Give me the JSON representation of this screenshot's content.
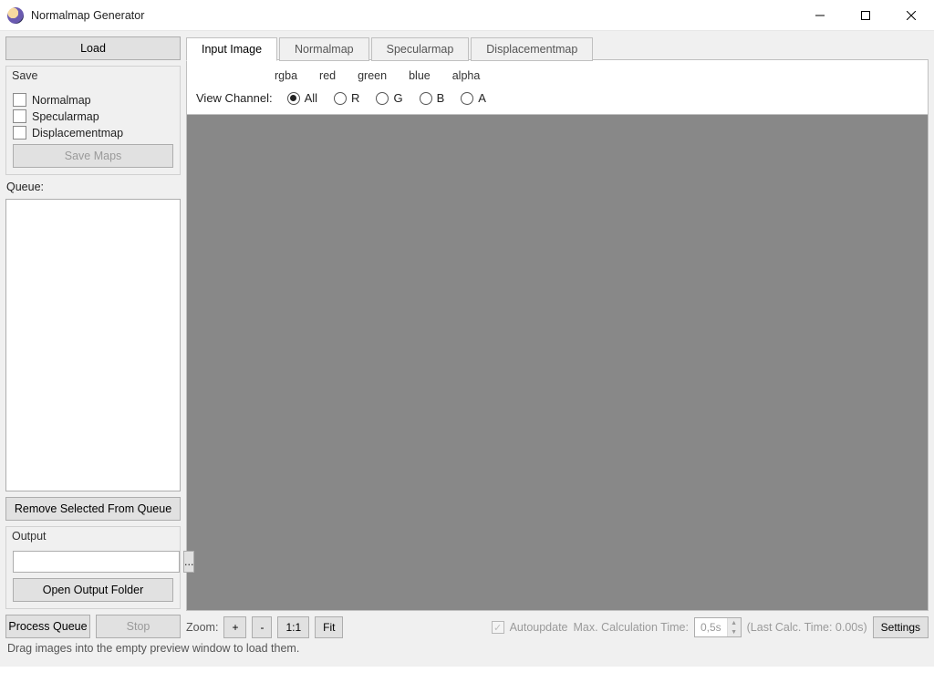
{
  "window": {
    "title": "Normalmap Generator"
  },
  "sidebar": {
    "load_label": "Load",
    "save_group_label": "Save",
    "save_checks": [
      {
        "label": "Normalmap"
      },
      {
        "label": "Specularmap"
      },
      {
        "label": "Displacementmap"
      }
    ],
    "save_maps_label": "Save Maps",
    "queue_label": "Queue:",
    "remove_queue_label": "Remove Selected From Queue",
    "output_group_label": "Output",
    "output_path_value": "",
    "browse_label": "...",
    "open_output_label": "Open Output Folder",
    "process_queue_label": "Process Queue",
    "stop_label": "Stop"
  },
  "tabs": {
    "items": [
      {
        "label": "Input Image"
      },
      {
        "label": "Normalmap"
      },
      {
        "label": "Specularmap"
      },
      {
        "label": "Displacementmap"
      }
    ],
    "active_index": 0
  },
  "input_panel": {
    "header_labels": [
      "rgba",
      "red",
      "green",
      "blue",
      "alpha"
    ],
    "view_channel_label": "View Channel:",
    "radio_options": [
      {
        "label": "All",
        "selected": true
      },
      {
        "label": "R",
        "selected": false
      },
      {
        "label": "G",
        "selected": false
      },
      {
        "label": "B",
        "selected": false
      },
      {
        "label": "A",
        "selected": false
      }
    ]
  },
  "bottombar": {
    "zoom_label": "Zoom:",
    "zoom_in_label": "+",
    "zoom_out_label": "-",
    "zoom_11_label": "1:1",
    "zoom_fit_label": "Fit",
    "autoupdate_label": "Autoupdate",
    "max_calc_label": "Max. Calculation Time:",
    "max_calc_value": "0,5s",
    "last_calc_label": "(Last Calc. Time: 0.00s)",
    "settings_label": "Settings"
  },
  "statusbar": {
    "text": "Drag images into the empty preview window to load them."
  }
}
